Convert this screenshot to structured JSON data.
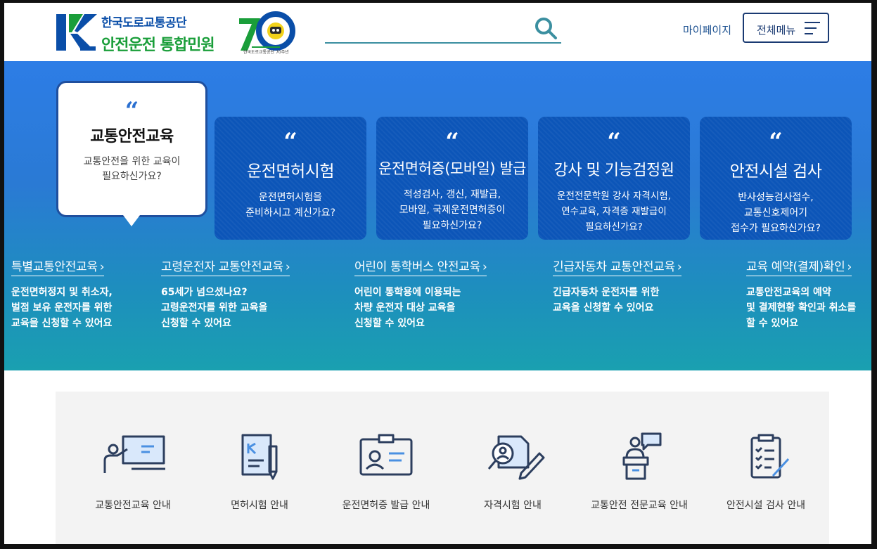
{
  "header": {
    "org_name": "한국도로교통공단",
    "service_name": "안전운전 통합민원",
    "anniversary_caption": "한국도로교통공단 70주년",
    "search_placeholder": "",
    "mypage_label": "마이페이지",
    "all_menu_label": "전체메뉴"
  },
  "hero": {
    "active_card": {
      "title": "교통안전교육",
      "desc_line1": "교통안전을 위한 교육이",
      "desc_line2": "필요하신가요?"
    },
    "cards": [
      {
        "title": "운전면허시험",
        "line1": "운전면허시험을",
        "line2": "준비하시고 계신가요?",
        "line3": ""
      },
      {
        "title": "운전면허증(모바일) 발급",
        "line1": "적성검사, 갱신, 재발급,",
        "line2": "모바일, 국제운전면허증이",
        "line3": "필요하신가요?"
      },
      {
        "title": "강사 및 기능검정원",
        "line1": "운전전문학원 강사 자격시험,",
        "line2": "연수교육, 자격증 재발급이",
        "line3": "필요하신가요?"
      },
      {
        "title": "안전시설 검사",
        "line1": "반사성능검사접수,",
        "line2": "교통신호제어기",
        "line3": "접수가 필요하신가요?"
      }
    ],
    "links": [
      {
        "title": "특별교통안전교육",
        "line1": "운전면허정지 및 취소자,",
        "line2": "벌점 보유 운전자를 위한",
        "line3": "교육을 신청할 수 있어요"
      },
      {
        "title": "고령운전자 교통안전교육",
        "line1": "65세가 넘으셨나요?",
        "line2": "고령운전자를 위한 교육을",
        "line3": "신청할 수 있어요"
      },
      {
        "title": "어린이 통학버스 안전교육",
        "line1": "어린이 통학용에 이용되는",
        "line2": "차량 운전자 대상 교육을",
        "line3": "신청할 수 있어요"
      },
      {
        "title": "긴급자동차 교통안전교육",
        "line1": "긴급자동차 운전자를 위한",
        "line2": "교육을 신청할 수 있어요",
        "line3": ""
      },
      {
        "title": "교육 예약(결제)확인",
        "line1": "교통안전교육의 예약",
        "line2": "및 결제현황 확인과 취소를",
        "line3": "할 수 있어요"
      }
    ],
    "chevron": "›"
  },
  "quick_menu": [
    {
      "label": "교통안전교육 안내",
      "icon": "teacher-board-icon"
    },
    {
      "label": "면허시험 안내",
      "icon": "license-document-pen-icon"
    },
    {
      "label": "운전면허증 발급 안내",
      "icon": "id-card-icon"
    },
    {
      "label": "자격시험 안내",
      "icon": "search-person-pen-icon"
    },
    {
      "label": "교통안전 전문교육 안내",
      "icon": "lecturer-podium-icon"
    },
    {
      "label": "안전시설 검사 안내",
      "icon": "checklist-clipboard-icon"
    }
  ],
  "colors": {
    "brand_blue": "#0a4ea8",
    "brand_green": "#1a9e3a",
    "card_blue": "#0c55b8",
    "hero_gradient_top": "#2d7de6",
    "hero_gradient_bottom": "#1aa0b0"
  }
}
